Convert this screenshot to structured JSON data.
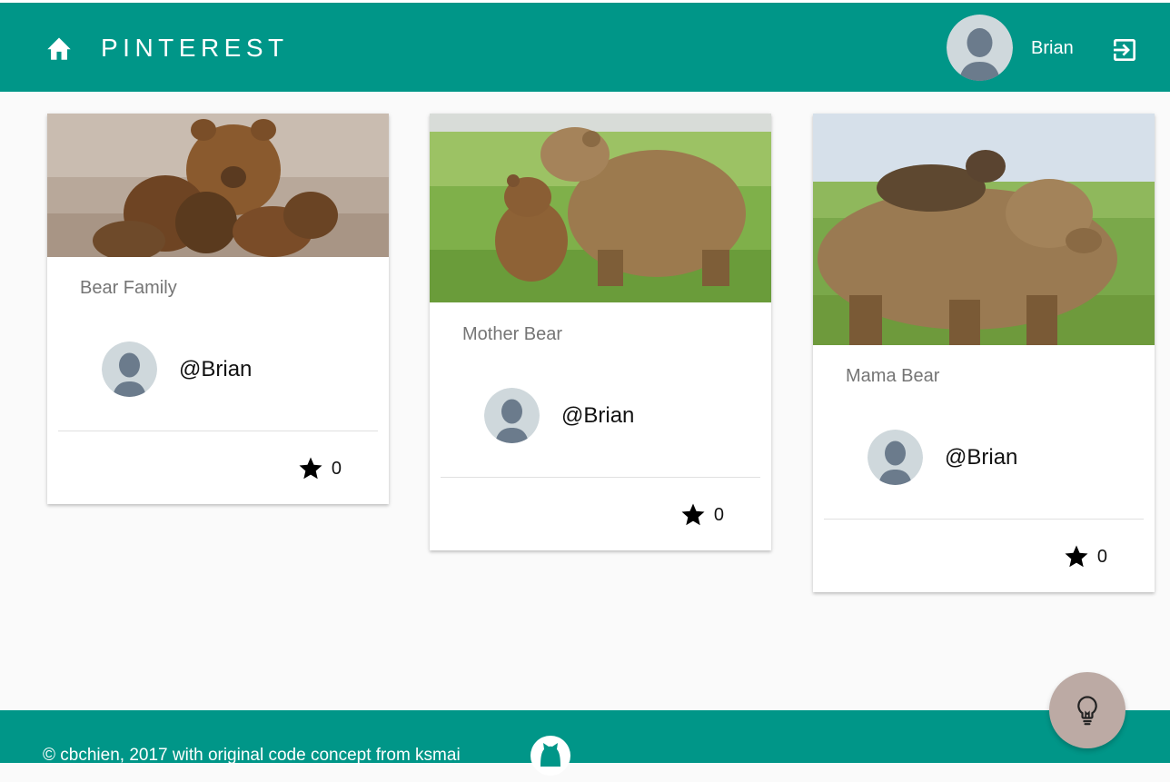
{
  "header": {
    "brand": "PINTEREST",
    "user_name": "Brian",
    "home_icon": "home-icon",
    "logout_icon": "logout-icon",
    "avatar_icon": "default-avatar-icon"
  },
  "colors": {
    "primary": "#009688",
    "fab": "#bcaaa4",
    "title_text": "#757575",
    "background": "#fafafa"
  },
  "cards": [
    {
      "title": "Bear Family",
      "author": "@Brian",
      "likes": "0",
      "image_desc": "bear-family-image"
    },
    {
      "title": "Mother Bear",
      "author": "@Brian",
      "likes": "0",
      "image_desc": "mother-bear-image"
    },
    {
      "title": "Mama Bear",
      "author": "@Brian",
      "likes": "0",
      "image_desc": "mama-bear-image"
    }
  ],
  "footer": {
    "text": "© cbchien, 2017 with original code concept from ksmai",
    "github_icon": "github-icon"
  },
  "fab": {
    "icon": "lightbulb-icon"
  }
}
